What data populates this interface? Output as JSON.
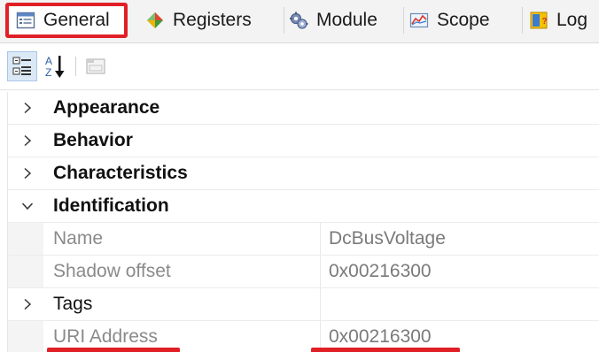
{
  "tabs": [
    {
      "label": "General",
      "icon": "properties-list-icon",
      "active": true
    },
    {
      "label": "Registers",
      "icon": "diamond-registers-icon",
      "active": false
    },
    {
      "label": "Module",
      "icon": "gears-module-icon",
      "active": false
    },
    {
      "label": "Scope",
      "icon": "line-chart-scope-icon",
      "active": false
    },
    {
      "label": "Log",
      "icon": "log-book-icon",
      "active": false
    }
  ],
  "toolbar": {
    "categorized_icon": "categorized-view-icon",
    "alphabetical_icon": "sort-alphabetical-icon",
    "property_pages_icon": "property-pages-icon"
  },
  "grid": {
    "categories": {
      "appearance": "Appearance",
      "behavior": "Behavior",
      "characteristics": "Characteristics",
      "identification": "Identification"
    },
    "properties": {
      "name": {
        "label": "Name",
        "value": "DcBusVoltage"
      },
      "shadow_offset": {
        "label": "Shadow offset",
        "value": "0x00216300"
      },
      "tags": {
        "label": "Tags",
        "value": ""
      },
      "uri_address": {
        "label": "URI Address",
        "value": "0x00216300"
      }
    }
  },
  "colors": {
    "highlight": "#e02026",
    "category_text": "#111111",
    "readonly_text": "#8a8a8a"
  }
}
